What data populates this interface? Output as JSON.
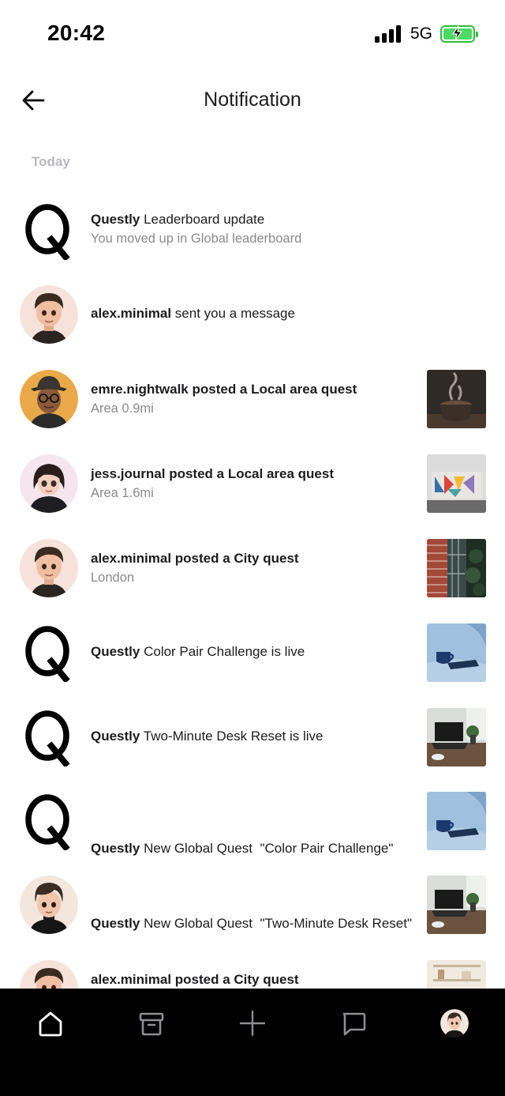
{
  "status_bar": {
    "time": "20:42",
    "network": "5G",
    "battery_state": "charging",
    "battery_color": "#4cd964"
  },
  "header": {
    "title": "Notification",
    "back_icon": "arrow-left-icon"
  },
  "section": {
    "label": "Today"
  },
  "notifications": [
    {
      "avatar": "questly-logo",
      "actor": "Questly",
      "actor_bold": true,
      "text": " Leaderboard update",
      "subtext": "You moved up in Global leaderboard",
      "thumb": ""
    },
    {
      "avatar": "alex-avatar",
      "actor": "alex.minimal",
      "text": " sent you a message",
      "subtext": "",
      "thumb": ""
    },
    {
      "avatar": "emre-avatar",
      "actor": "emre.nightwalk posted a Local area quest",
      "text": "",
      "subtext": "Area 0.9mi",
      "thumb": "coffee-cup-photo"
    },
    {
      "avatar": "jess-avatar",
      "actor": "jess.journal posted a Local area quest",
      "text": "",
      "subtext": "Area 1.6mi",
      "thumb": "mural-wall-photo"
    },
    {
      "avatar": "alex-avatar",
      "actor": "alex.minimal posted a City quest",
      "text": "",
      "subtext": "London",
      "thumb": "city-building-photo"
    },
    {
      "avatar": "questly-logo",
      "actor": "Questly",
      "text": " Color Pair Challenge is live",
      "subtext": "",
      "thumb": "blue-mug-photo"
    },
    {
      "avatar": "questly-logo",
      "actor": "Questly",
      "text": " Two-Minute Desk Reset is live",
      "subtext": "",
      "thumb": "desk-laptop-photo"
    },
    {
      "avatar": "questly-logo",
      "actor": "Questly",
      "text": " New Global Quest  \"Color Pair Challenge\"",
      "subtext": "",
      "thumb": "blue-mug-photo"
    },
    {
      "avatar": "boy-avatar",
      "actor": "Questly",
      "text": " New Global Quest  \"Two-Minute Desk Reset\"",
      "subtext": "",
      "thumb": "desk-laptop-photo"
    },
    {
      "avatar": "alex-avatar",
      "actor": "alex.minimal posted a City quest",
      "text": "",
      "subtext": "",
      "thumb": "shelf-photo"
    }
  ],
  "bottom_nav": {
    "items": [
      "home-icon",
      "archive-icon",
      "plus-icon",
      "chat-icon",
      "profile-avatar"
    ]
  }
}
